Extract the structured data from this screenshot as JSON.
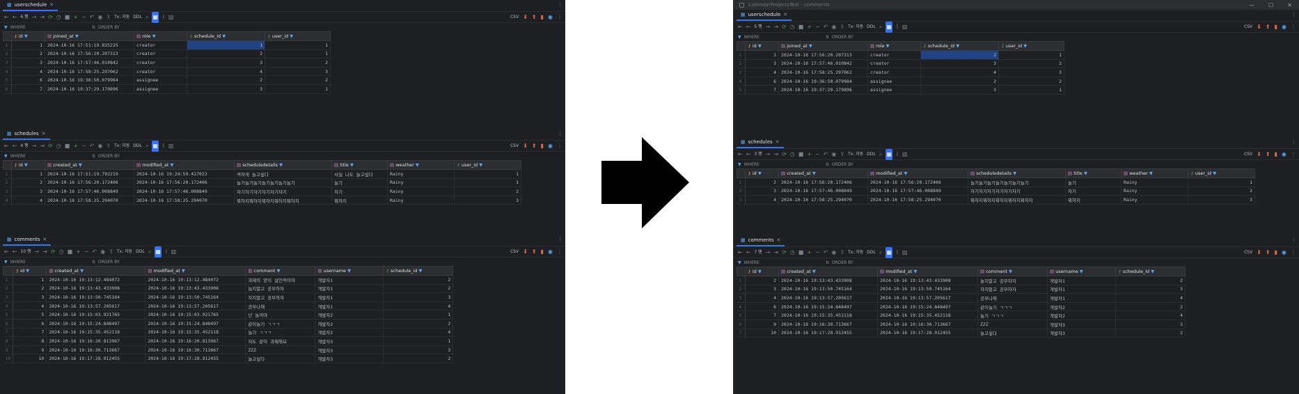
{
  "right_window_title": "CalendarProjectsTest - comments",
  "toolbar": {
    "tx_label": "Tx: 자동",
    "ddl_label": "DDL",
    "csv_label": "CSV"
  },
  "filter": {
    "where_label": "WHERE",
    "orderby_label": "ORDER BY"
  },
  "left": {
    "userschedule": {
      "tab": "userschedule",
      "rows_label": "6 행",
      "columns": [
        "id",
        "joined_at",
        "role",
        "schedule_id",
        "user_id"
      ],
      "rows": [
        [
          "1",
          "2024-10-16 17:51:19.835225",
          "creator",
          "1",
          "1"
        ],
        [
          "2",
          "2024-10-16 17:56:20.207313",
          "creator",
          "2",
          "1"
        ],
        [
          "3",
          "2024-10-16 17:57:46.010842",
          "creator",
          "3",
          "2"
        ],
        [
          "4",
          "2024-10-16 17:58:25.297062",
          "creator",
          "4",
          "3"
        ],
        [
          "6",
          "2024-10-16 19:36:50.079984",
          "assignee",
          "2",
          "2"
        ],
        [
          "7",
          "2024-10-16 19:37:29.179896",
          "assignee",
          "3",
          "1"
        ]
      ]
    },
    "schedules": {
      "tab": "schedules",
      "rows_label": "4 행",
      "columns": [
        "id",
        "created_at",
        "modified_at",
        "scheduledetails",
        "title",
        "weather",
        "user_id"
      ],
      "rows": [
        [
          "1",
          "2024-10-16 17:51:19.792219",
          "2024-10-16 19:24:59.417022",
          "격하게 놀고싶다",
          "사실 나도 놀고싶다",
          "Rainy",
          "1"
        ],
        [
          "2",
          "2024-10-16 17:56:20.172406",
          "2024-10-16 17:56:20.172406",
          "놀기놀기놀기놀기놀기놀기놀기",
          "놀기",
          "Rainy",
          "1"
        ],
        [
          "3",
          "2024-10-16 17:57:46.008849",
          "2024-10-16 17:57:46.008849",
          "자기자기자기자기자기자기",
          "자기",
          "Rainy",
          "2"
        ],
        [
          "4",
          "2024-10-16 17:58:25.294070",
          "2024-10-16 17:58:25.294070",
          "뭐하지뭐하지뭐하지뭐하지뭐하지",
          "뭐하지",
          "Rainy",
          "3"
        ]
      ]
    },
    "comments": {
      "tab": "comments",
      "rows_label": "10 행",
      "columns": [
        "id",
        "created_at",
        "modified_at",
        "comment",
        "username",
        "schedule_id"
      ],
      "rows": [
        [
          "1",
          "2024-10-16 19:13:12.484072",
          "2024-10-16 19:13:12.484072",
          "과제의 양이 살인적이야",
          "개발자1",
          "2"
        ],
        [
          "2",
          "2024-10-16 19:13:43.433908",
          "2024-10-16 19:13:43.433908",
          "놀지말고 공부하자",
          "개발자1",
          "2"
        ],
        [
          "3",
          "2024-10-16 19:13:50.745164",
          "2024-10-16 19:13:50.745164",
          "자지말고 공부하자",
          "개발자1",
          "3"
        ],
        [
          "4",
          "2024-10-16 19:13:57.205617",
          "2024-10-16 19:13:57.205617",
          "공부나해",
          "개발자1",
          "4"
        ],
        [
          "5",
          "2024-10-16 19:15:03.921765",
          "2024-10-16 19:15:03.921765",
          "난 놀꺼야",
          "개발자2",
          "1"
        ],
        [
          "6",
          "2024-10-16 19:15:24.848497",
          "2024-10-16 19:15:24.848497",
          "같이놀기 ㄱㄱㄱ",
          "개발자2",
          "2"
        ],
        [
          "7",
          "2024-10-16 19:15:35.452118",
          "2024-10-16 19:15:35.452118",
          "놀기 ㄱㄱㄱ",
          "개발자2",
          "4"
        ],
        [
          "8",
          "2024-10-16 19:16:20.813967",
          "2024-10-16 19:16:20.813967",
          "저도 같이 과제해요",
          "개발자3",
          "1"
        ],
        [
          "9",
          "2024-10-16 19:16:30.713667",
          "2024-10-16 19:16:30.713667",
          "ZZZ",
          "개발자3",
          "3"
        ],
        [
          "10",
          "2024-10-16 19:17:28.912455",
          "2024-10-16 19:17:28.912455",
          "놀고싶다",
          "개발자3",
          "2"
        ]
      ]
    }
  },
  "right": {
    "userschedule": {
      "tab": "userschedule",
      "rows_label": "5 행",
      "columns": [
        "id",
        "joined_at",
        "role",
        "schedule_id",
        "user_id"
      ],
      "rows": [
        [
          "2",
          "2024-10-16 17:56:20.207313",
          "creator",
          "2",
          "1"
        ],
        [
          "3",
          "2024-10-16 17:57:46.010842",
          "creator",
          "3",
          "2"
        ],
        [
          "4",
          "2024-10-16 17:58:25.297062",
          "creator",
          "4",
          "3"
        ],
        [
          "6",
          "2024-10-16 19:36:50.079984",
          "assignee",
          "2",
          "2"
        ],
        [
          "7",
          "2024-10-16 19:37:29.179896",
          "assignee",
          "3",
          "1"
        ]
      ]
    },
    "schedules": {
      "tab": "schedules",
      "rows_label": "3 행",
      "columns": [
        "id",
        "created_at",
        "modified_at",
        "scheduledetails",
        "title",
        "weather",
        "user_id"
      ],
      "rows": [
        [
          "2",
          "2024-10-16 17:56:20.172406",
          "2024-10-16 17:56:20.172406",
          "놀기놀기놀기놀기놀기놀기놀기",
          "놀기",
          "Rainy",
          "1"
        ],
        [
          "3",
          "2024-10-16 17:57:46.008849",
          "2024-10-16 17:57:46.008849",
          "자기자기자기자기자기자기",
          "자기",
          "Rainy",
          "2"
        ],
        [
          "4",
          "2024-10-16 17:58:25.294070",
          "2024-10-16 17:58:25.294070",
          "뭐하지뭐하지뭐하지뭐하지뭐하지",
          "뭐하지",
          "Rainy",
          "3"
        ]
      ]
    },
    "comments": {
      "tab": "comments",
      "rows_label": "7 행",
      "columns": [
        "id",
        "created_at",
        "modified_at",
        "comment",
        "username",
        "schedule_id"
      ],
      "rows": [
        [
          "2",
          "2024-10-16 19:13:43.433908",
          "2024-10-16 19:13:43.433908",
          "놀지말고 공부하자",
          "개발자1",
          "2"
        ],
        [
          "3",
          "2024-10-16 19:13:50.745164",
          "2024-10-16 19:13:50.745164",
          "자지말고 공부하자",
          "개발자1",
          "3"
        ],
        [
          "4",
          "2024-10-16 19:13:57.205617",
          "2024-10-16 19:13:57.205617",
          "공부나해",
          "개발자1",
          "4"
        ],
        [
          "6",
          "2024-10-16 19:15:24.848497",
          "2024-10-16 19:15:24.848497",
          "같이놀기 ㄱㄱㄱ",
          "개발자2",
          "2"
        ],
        [
          "7",
          "2024-10-16 19:15:35.452118",
          "2024-10-16 19:15:35.452118",
          "놀기 ㄱㄱㄱ",
          "개발자2",
          "4"
        ],
        [
          "9",
          "2024-10-16 19:16:30.713667",
          "2024-10-16 19:16:30.713667",
          "ZZZ",
          "개발자3",
          "3"
        ],
        [
          "10",
          "2024-10-16 19:17:28.912455",
          "2024-10-16 19:17:28.912455",
          "놀고싶다",
          "개발자3",
          "2"
        ]
      ]
    }
  }
}
